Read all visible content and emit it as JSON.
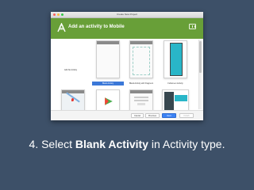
{
  "window": {
    "title": "Create New Project"
  },
  "header": {
    "title": "Add an activity to Mobile"
  },
  "gallery": {
    "no_activity_label": "Add No Activity",
    "tiles": [
      {
        "label": "Blank Activity",
        "selected": true
      },
      {
        "label": "Blank Activity with Fragment",
        "selected": false
      },
      {
        "label": "Fullscreen Activity",
        "selected": false
      },
      {
        "label": "",
        "selected": false
      },
      {
        "label": "",
        "selected": false
      },
      {
        "label": "",
        "selected": false
      },
      {
        "label": "",
        "selected": false
      }
    ]
  },
  "footer": {
    "cancel_label": "Cancel",
    "previous_label": "Previous",
    "next_label": "Next",
    "finish_label": "Finish"
  },
  "caption": {
    "prefix": "4. Select ",
    "emphasis": "Blank Activity",
    "suffix": " in Activity type."
  },
  "colors": {
    "background": "#3d5068",
    "header_green": "#689f38",
    "selection_blue": "#3b78d8",
    "primary_button": "#3b82f5"
  }
}
